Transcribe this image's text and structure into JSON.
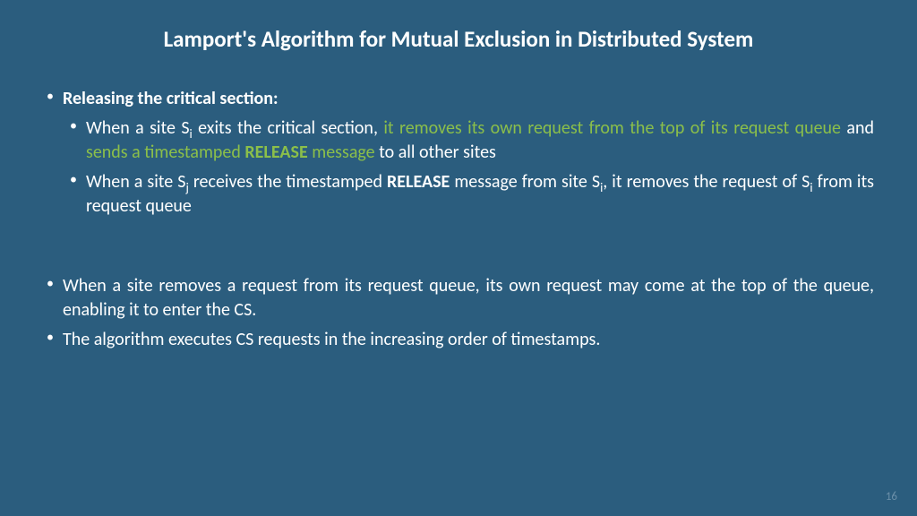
{
  "title": "Lamport's Algorithm for Mutual Exclusion in Distributed System",
  "section_header": "Releasing the critical section:",
  "b1": {
    "p1": "When a site S",
    "sub1": "i",
    "p2": " exits the critical section, ",
    "g1": "it removes its own request from the top of its request queue",
    "p3": " and ",
    "g2a": "sends a timestamped ",
    "g2b": "RELEASE",
    "g2c": " message",
    "p4": " to all other sites"
  },
  "b2": {
    "p1": "When a site S",
    "sub1": "j",
    "p2": " receives the timestamped ",
    "bold1": "RELEASE",
    "p3": " message from site S",
    "sub2": "i",
    "p4": ", it removes the request of S",
    "sub3": "i",
    "p5": " from its request queue"
  },
  "b3": "When a site removes a request from its request queue, its own request may come at the top of the queue, enabling it to enter the CS.",
  "b4": "The algorithm executes CS requests in the increasing order of timestamps.",
  "page_number": "16"
}
